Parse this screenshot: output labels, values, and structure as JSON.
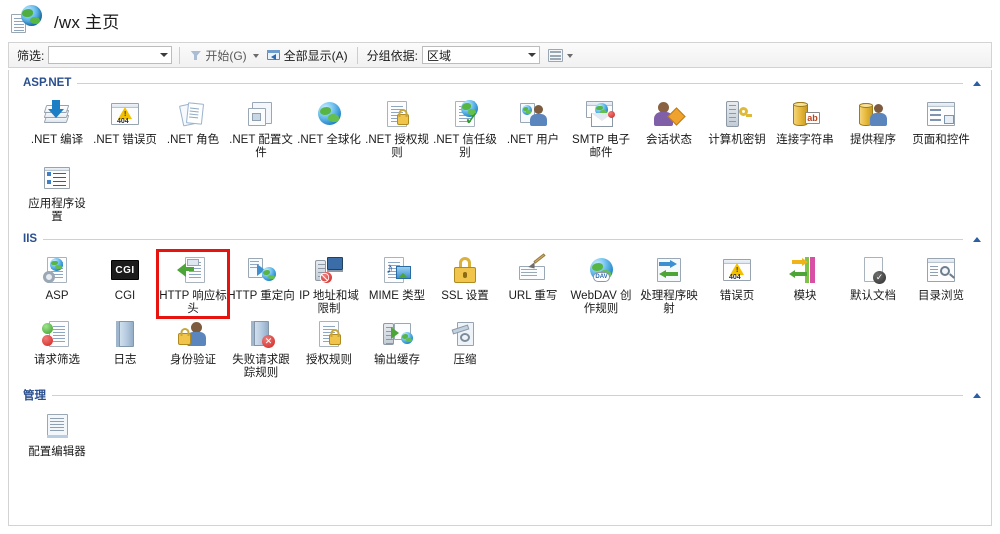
{
  "window": {
    "title": "/wx 主页",
    "icon": "site-home-icon"
  },
  "toolbar": {
    "filter_label": "筛选:",
    "filter_value": "",
    "filter_placeholder": "",
    "start_label": "开始(G)",
    "show_all_label": "全部显示(A)",
    "group_by_label": "分组依据:",
    "group_by_value": "区域",
    "view_mode_icon": "grid-view-icon"
  },
  "groups": [
    {
      "id": "aspnet",
      "title": "ASP.NET",
      "collapse_icon": "chevron-up-icon",
      "tiles": [
        {
          "label": ".NET 编译",
          "icon": "net-compilation-icon"
        },
        {
          "label": ".NET 错误页",
          "icon": "net-error-pages-icon"
        },
        {
          "label": ".NET 角色",
          "icon": "net-roles-icon"
        },
        {
          "label": ".NET 配置文件",
          "icon": "net-profile-icon"
        },
        {
          "label": ".NET 全球化",
          "icon": "net-globalization-icon"
        },
        {
          "label": ".NET 授权规则",
          "icon": "net-authorization-rules-icon"
        },
        {
          "label": ".NET 信任级别",
          "icon": "net-trust-levels-icon"
        },
        {
          "label": ".NET 用户",
          "icon": "net-users-icon"
        },
        {
          "label": "SMTP 电子邮件",
          "icon": "smtp-email-icon"
        },
        {
          "label": "会话状态",
          "icon": "session-state-icon"
        },
        {
          "label": "计算机密钥",
          "icon": "machine-key-icon"
        },
        {
          "label": "连接字符串",
          "icon": "connection-strings-icon"
        },
        {
          "label": "提供程序",
          "icon": "providers-icon"
        },
        {
          "label": "页面和控件",
          "icon": "pages-and-controls-icon"
        },
        {
          "label": "应用程序设置",
          "icon": "application-settings-icon"
        }
      ]
    },
    {
      "id": "iis",
      "title": "IIS",
      "collapse_icon": "chevron-up-icon",
      "tiles": [
        {
          "label": "ASP",
          "icon": "asp-icon"
        },
        {
          "label": "CGI",
          "icon": "cgi-icon"
        },
        {
          "label": "HTTP 响应标头",
          "icon": "http-response-headers-icon",
          "selected": true
        },
        {
          "label": "HTTP 重定向",
          "icon": "http-redirect-icon"
        },
        {
          "label": "IP 地址和域限制",
          "icon": "ip-address-domain-restrictions-icon"
        },
        {
          "label": "MIME 类型",
          "icon": "mime-types-icon"
        },
        {
          "label": "SSL 设置",
          "icon": "ssl-settings-icon"
        },
        {
          "label": "URL 重写",
          "icon": "url-rewrite-icon"
        },
        {
          "label": "WebDAV 创作规则",
          "icon": "webdav-authoring-rules-icon"
        },
        {
          "label": "处理程序映射",
          "icon": "handler-mappings-icon"
        },
        {
          "label": "错误页",
          "icon": "error-pages-icon"
        },
        {
          "label": "模块",
          "icon": "modules-icon"
        },
        {
          "label": "默认文档",
          "icon": "default-document-icon"
        },
        {
          "label": "目录浏览",
          "icon": "directory-browsing-icon"
        },
        {
          "label": "请求筛选",
          "icon": "request-filtering-icon"
        },
        {
          "label": "日志",
          "icon": "logging-icon"
        },
        {
          "label": "身份验证",
          "icon": "authentication-icon"
        },
        {
          "label": "失败请求跟踪规则",
          "icon": "failed-request-tracing-rules-icon"
        },
        {
          "label": "授权规则",
          "icon": "authorization-rules-icon"
        },
        {
          "label": "输出缓存",
          "icon": "output-caching-icon"
        },
        {
          "label": "压缩",
          "icon": "compression-icon"
        }
      ]
    },
    {
      "id": "management",
      "title": "管理",
      "collapse_icon": "chevron-up-icon",
      "tiles": [
        {
          "label": "配置编辑器",
          "icon": "configuration-editor-icon"
        }
      ]
    }
  ],
  "colors": {
    "selection_highlight": "#e8120e",
    "group_title": "#2a4f8f",
    "panel_border": "#d3d3d3"
  }
}
